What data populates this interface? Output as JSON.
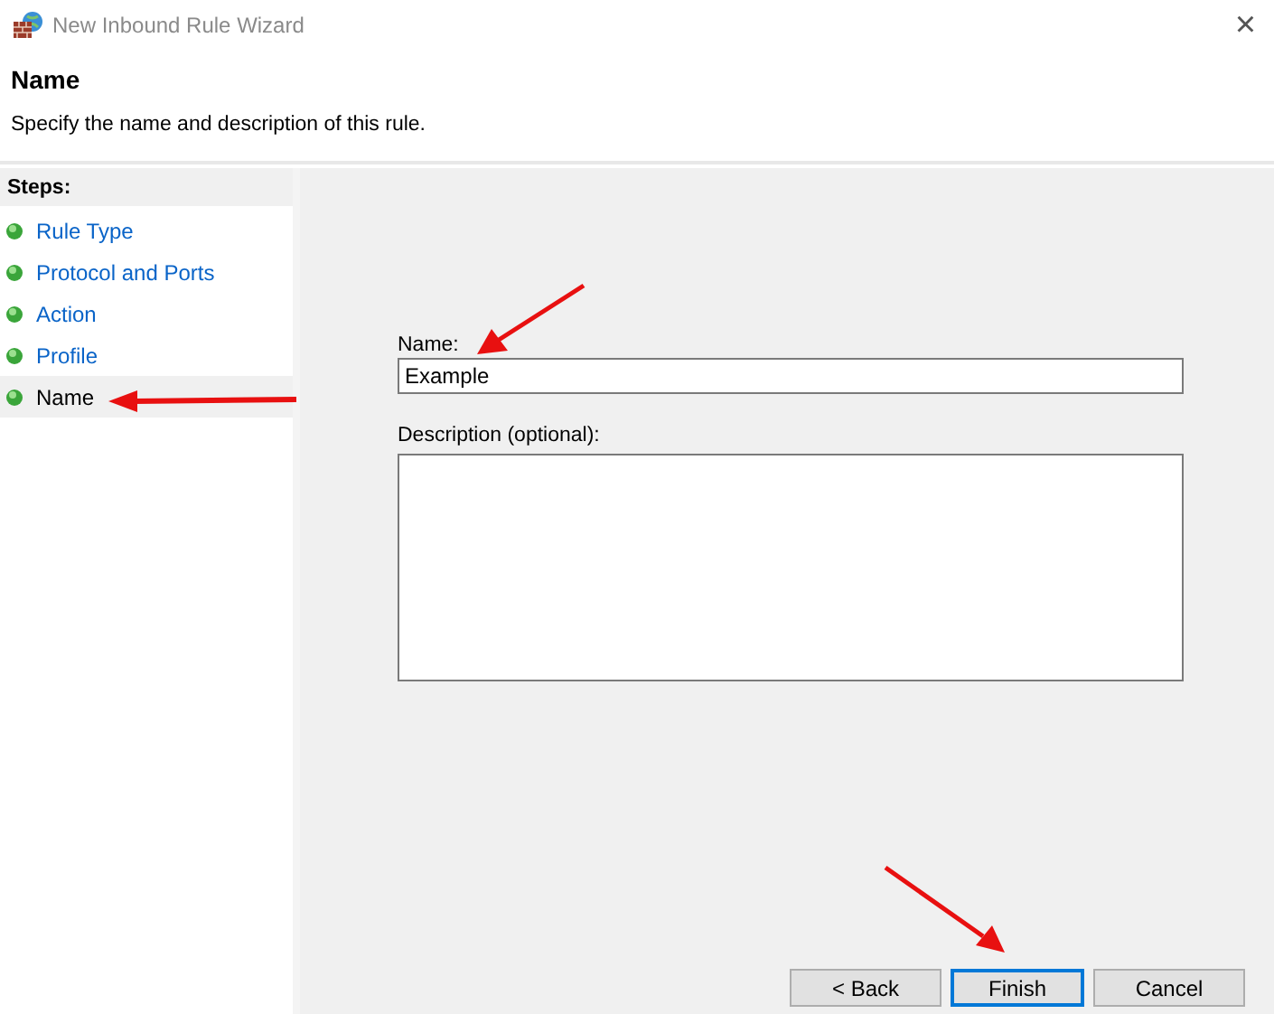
{
  "window": {
    "title": "New Inbound Rule Wizard",
    "close": "×"
  },
  "header": {
    "title": "Name",
    "subtitle": "Specify the name and description of this rule."
  },
  "steps": {
    "heading": "Steps:",
    "items": [
      {
        "label": "Rule Type",
        "selected": false
      },
      {
        "label": "Protocol and Ports",
        "selected": false
      },
      {
        "label": "Action",
        "selected": false
      },
      {
        "label": "Profile",
        "selected": false
      },
      {
        "label": "Name",
        "selected": true
      }
    ]
  },
  "form": {
    "name_label": "Name:",
    "name_value": "Example",
    "description_label": "Description (optional):"
  },
  "buttons": [
    {
      "label": "< Back",
      "default": false
    },
    {
      "label": "Finish",
      "default": true
    },
    {
      "label": "Cancel",
      "default": false
    }
  ]
}
